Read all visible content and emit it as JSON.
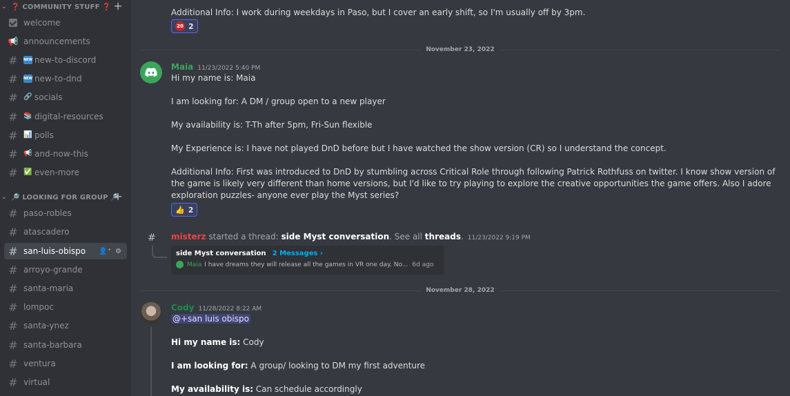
{
  "sidebar": {
    "category1": {
      "label": "❓ COMMUNITY STUFF ❓"
    },
    "channels1": [
      {
        "label": "welcome"
      },
      {
        "label": "announcements"
      },
      {
        "label": "new-to-discord",
        "emoji": "NEW"
      },
      {
        "label": "new-to-dnd",
        "emoji": "NEW"
      },
      {
        "label": "socials",
        "emoji": "🔗"
      },
      {
        "label": "digital-resources",
        "emoji": "📚"
      },
      {
        "label": "polls",
        "emoji": "📊"
      },
      {
        "label": "and-now-this",
        "emoji": "📢"
      },
      {
        "label": "even-more",
        "emoji": "✅"
      }
    ],
    "category2": {
      "label": "🔎 LOOKING FOR GROUP 🔎"
    },
    "channels2": [
      {
        "label": "paso-robles"
      },
      {
        "label": "atascadero"
      },
      {
        "label": "san-luis-obispo"
      },
      {
        "label": "arroyo-grande"
      },
      {
        "label": "santa-maria"
      },
      {
        "label": "lompoc"
      },
      {
        "label": "santa-ynez"
      },
      {
        "label": "santa-barbara"
      },
      {
        "label": "ventura"
      },
      {
        "label": "virtual"
      }
    ]
  },
  "messages": {
    "prev_line": "Additional Info: I work during weekdays in Paso, but I cover an early shift, so I'm usually off by 3pm.",
    "prev_reaction": {
      "emoji": "20",
      "count": "2"
    },
    "divider1": "November 23, 2022",
    "maia": {
      "name": "Maia",
      "timestamp": "11/23/2022 5:40 PM",
      "line1": "Hi my name is: Maia",
      "line2": "I am looking for: A DM / group open to a new player",
      "line3": "My availability is: T-Th after 5pm, Fri-Sun flexible",
      "line4": "My Experience is: I have not played DnD before but I have watched the show version (CR) so I understand the concept.",
      "line5": "Additional Info: First was introduced to DnD by stumbling across Critical Role through following Patrick Rothfuss on twitter. I know show version of the game is likely very different than home versions, but I'd like to try playing to explore the creative opportunities the game offers. Also I adore exploration puzzles- anyone ever play the Myst series?",
      "reaction": {
        "emoji": "👍",
        "count": "2"
      }
    },
    "thread": {
      "user": "misterz",
      "text_started": " started a thread: ",
      "thread_name": "side Myst conversation",
      "text_see": ". See all ",
      "threads_link": "threads",
      "text_dot": ".",
      "timestamp": "11/23/2022 9:19 PM",
      "box_title": "side Myst conversation",
      "box_count": "2 Messages ›",
      "preview_user": "Maia",
      "preview_text": "I have dreams they will release all the games in VR one day. No...",
      "preview_age": "6d ago"
    },
    "divider2": "November 28, 2022",
    "cody": {
      "name": "Cody",
      "timestamp": "11/28/2022 8:22 AM",
      "mention": "@+san luis obispo",
      "l1_label": "Hi my name is:",
      "l1_value": " Cody",
      "l2_label": "I am looking for:",
      "l2_value": " A group/ looking to DM my first adventure",
      "l3_label": "My availability is:",
      "l3_value": " Can schedule accordingly"
    }
  },
  "colors": {
    "maia": "#3ba55c",
    "misterz": "#ed4245",
    "cody": "#1f8b4c",
    "link": "#00aff4"
  }
}
